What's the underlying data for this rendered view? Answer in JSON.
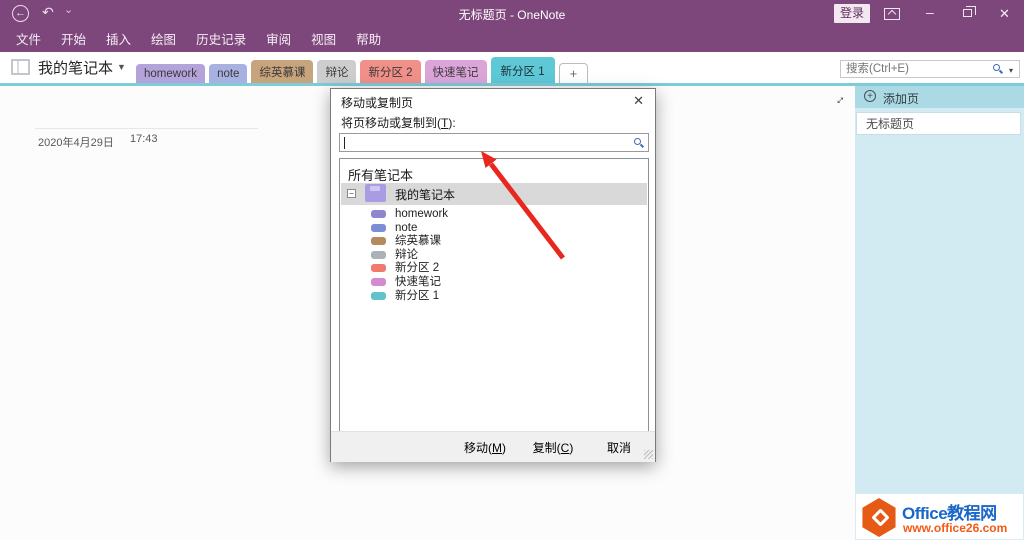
{
  "colors": {
    "titlebar": "#7e477c",
    "accent_teal": "#5ec8d7",
    "tab_underline": "#7ecbd9",
    "sidebar_header": "#abd9e4",
    "sidebar_body": "#d2ebf3",
    "arrow_red": "#e8281f"
  },
  "icons": {
    "back": "←",
    "undo": "↶",
    "qat_chevron": "⌄",
    "minimize": "–",
    "close": "✕",
    "notebook_dropdown": "▼",
    "search_dropdown": "▾",
    "expand": "↔",
    "add_circle_plus": "+",
    "tree_collapse": "−",
    "dialog_close": "✕"
  },
  "titlebar": {
    "title": "无标题页 - OneNote",
    "signin": "登录"
  },
  "menu": {
    "items": [
      "文件",
      "开始",
      "插入",
      "绘图",
      "历史记录",
      "审阅",
      "视图",
      "帮助"
    ]
  },
  "notebook_bar": {
    "name": "我的笔记本",
    "search_placeholder": "搜索(Ctrl+E)",
    "new_tab": "+",
    "tabs": [
      {
        "label": "homework",
        "color": "#b4a3da",
        "active": false
      },
      {
        "label": "note",
        "color": "#a9b1e1",
        "active": false
      },
      {
        "label": "综英慕课",
        "color": "#c7a47b",
        "active": false
      },
      {
        "label": "辩论",
        "color": "#cdcdcd",
        "active": false
      },
      {
        "label": "新分区 2",
        "color": "#f19089",
        "active": false
      },
      {
        "label": "快速笔记",
        "color": "#dca5da",
        "active": false
      },
      {
        "label": "新分区 1",
        "color": "#5ec8d7",
        "active": true
      }
    ]
  },
  "canvas": {
    "date": "2020年4月29日",
    "time": "17:43"
  },
  "dialog": {
    "title": "移动或复制页",
    "label": {
      "pre": "将页移动或复制到(",
      "key": "T",
      "post": "):"
    },
    "input_value": "",
    "list_header": "所有笔记本",
    "notebook": {
      "name": "我的笔记本",
      "color": "#a99ce3"
    },
    "sections": [
      {
        "name": "homework",
        "color": "#8e85cf"
      },
      {
        "name": "note",
        "color": "#7c8fd6"
      },
      {
        "name": "综英慕课",
        "color": "#b58a5e"
      },
      {
        "name": "辩论",
        "color": "#aab2b7"
      },
      {
        "name": "新分区 2",
        "color": "#f2796d"
      },
      {
        "name": "快速笔记",
        "color": "#d38ad2"
      },
      {
        "name": "新分区 1",
        "color": "#63c1cc"
      }
    ],
    "buttons": {
      "move": {
        "pre": "移动(",
        "key": "M",
        "post": ")",
        "enabled": false
      },
      "copy": {
        "pre": "复制(",
        "key": "C",
        "post": ")",
        "enabled": false
      },
      "cancel": {
        "label": "取消",
        "enabled": true
      }
    }
  },
  "sidebar": {
    "add_page": "添加页",
    "pages": [
      {
        "title": "无标题页",
        "selected": true
      }
    ]
  },
  "watermark": {
    "title": "Office教程网",
    "url": "www.office26.com"
  }
}
